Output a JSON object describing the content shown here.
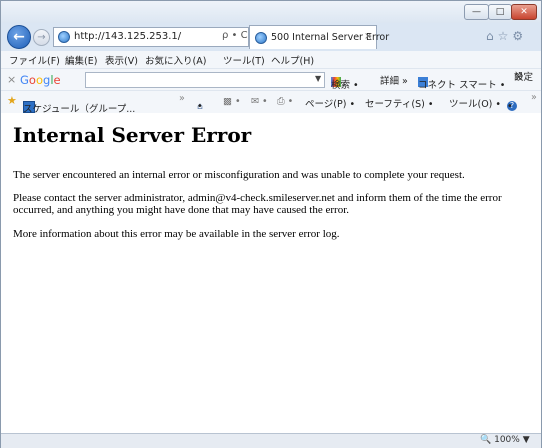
{
  "browser": {
    "url": "http://143.125.253.1/",
    "addr_tools": "ρ • C",
    "tab_title": "500 Internal Server Error",
    "tab_close": "×",
    "nav_right_icons": "⌂☆⚙"
  },
  "window_controls": {
    "minimize": "—",
    "maximize": "□",
    "close": "✕"
  },
  "menu": [
    "ファイル(F)",
    "編集(E)",
    "表示(V)",
    "お気に入り(A)",
    "ツール(T)",
    "ヘルプ(H)"
  ],
  "google_toolbar": {
    "close": "×",
    "logo": "Google",
    "search_value": "",
    "search_button": "検索 •",
    "more": "詳細 »",
    "connect": "コネクト スマート •",
    "settings": "設定"
  },
  "favorites_bar": {
    "favorite_item": "スケジュール（グループ...",
    "home_menu": "•",
    "page_menu": "ページ(P) •",
    "safety_menu": "セーフティ(S) •",
    "tools_menu": "ツール(O) •",
    "help_menu": "•"
  },
  "page": {
    "heading": "Internal Server Error",
    "paragraphs": [
      "The server encountered an internal error or misconfiguration and was unable to complete your request.",
      "Please contact the server administrator, admin@v4-check.smileserver.net and inform them of the time the error occurred, and anything you might have done that may have caused the error.",
      "More information about this error may be available in the server error log."
    ]
  },
  "status": {
    "zoom": "100%"
  },
  "colors": {
    "google_blue": "#4285f4",
    "google_red": "#ea4335",
    "google_yellow": "#fbbc05",
    "google_green": "#34a853"
  }
}
